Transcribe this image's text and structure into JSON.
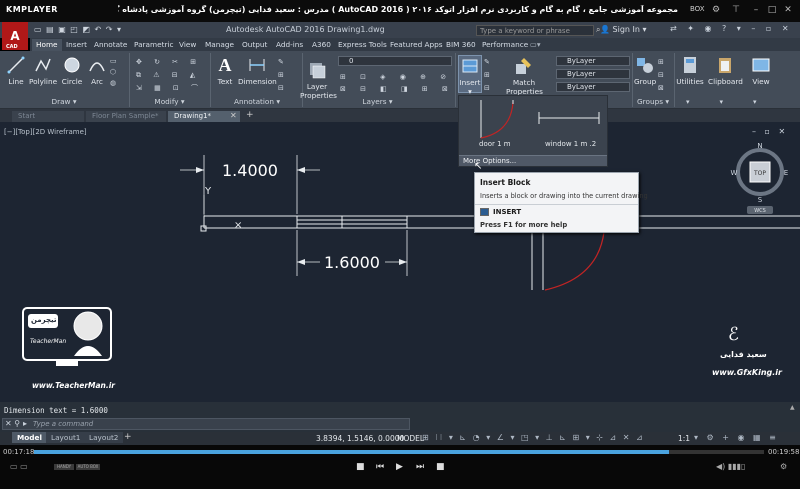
{
  "player": {
    "logo": "KMPLAYER",
    "title": "مجموعه آموزشی جامع ، گام به گام و کاربردی نرم افزار اتوکد ۲۰۱۶ ( AutoCAD 2016 ) مدرس : سعید فدایی (تیچرمن) گروه آموزشی پادشاه گرافیست ها",
    "box_label": "BOX",
    "current_time": "00:17:18",
    "total_time": "00:19:58",
    "progress": 0.87,
    "button_labels": [
      "HANDY",
      "AUTO BOX"
    ]
  },
  "app": {
    "logo": "A",
    "cad_badge": "CAD",
    "doc_title": "Autodesk AutoCAD 2016    Drawing1.dwg",
    "search_placeholder": "Type a keyword or phrase",
    "sign_in": "Sign In"
  },
  "tabs": [
    "Home",
    "Insert",
    "Annotate",
    "Parametric",
    "View",
    "Manage",
    "Output",
    "Add-ins",
    "A360",
    "Express Tools",
    "Featured Apps",
    "BIM 360",
    "Performance"
  ],
  "ribbon": {
    "draw": {
      "label": "Draw",
      "buttons": [
        "Line",
        "Polyline",
        "Circle",
        "Arc"
      ]
    },
    "modify": {
      "label": "Modify"
    },
    "annotation": {
      "label": "Annotation",
      "buttons": [
        "Text",
        "Dimension"
      ]
    },
    "layers": {
      "label": "Layers",
      "button": "Layer Properties",
      "layer_value": "0"
    },
    "block": {
      "insert": "Insert"
    },
    "properties": {
      "match": "Match Properties",
      "combos": [
        "ByLayer",
        "ByLayer",
        "ByLayer"
      ]
    },
    "groups": {
      "label": "Groups",
      "button": "Group"
    },
    "utilities": "Utilities",
    "clipboard": "Clipboard",
    "view": "View"
  },
  "file_tabs": [
    "Start",
    "Floor Plan Sample*",
    "Drawing1*"
  ],
  "viewport_label": "[−][Top][2D Wireframe]",
  "insert_dropdown": {
    "items": [
      "door 1 m",
      "window 1 m .2"
    ],
    "more": "More Options..."
  },
  "tooltip": {
    "title": "Insert Block",
    "description": "Inserts a block or drawing into the current drawing",
    "command": "INSERT",
    "help": "Press F1 for more help"
  },
  "drawing": {
    "dim_top": "1.4000",
    "dim_bottom": "1.6000",
    "y_label": "Y"
  },
  "viewcube": {
    "top": "TOP",
    "n": "N",
    "w": "W",
    "e": "E",
    "s": "S",
    "wcs": "WCS"
  },
  "watermark": {
    "left_site": "www.TeacherMan.ir",
    "left_brand": "TeacherMan",
    "left_logo": "تیچرمن",
    "right_name": "سعید فدایی",
    "right_site": "www.GfxKing.ir"
  },
  "command": {
    "history": "Dimension text = 1.6000",
    "placeholder": "Type a command"
  },
  "layouts": [
    "Model",
    "Layout1",
    "Layout2"
  ],
  "status": {
    "coords": "3.8394, 1.5146, 0.0000",
    "model": "MODEL",
    "scale": "1:1"
  }
}
